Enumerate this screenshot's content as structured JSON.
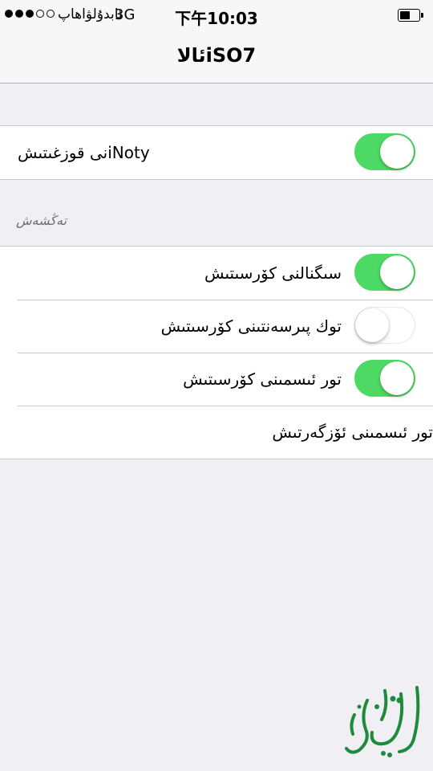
{
  "status_bar": {
    "signal_full": 3,
    "signal_total": 5,
    "carrier": "ئابدۇلۋاھاپ",
    "network": "3G",
    "time": "下午10:03",
    "battery_level": 0.55
  },
  "nav": {
    "title": "ئالاiSO7"
  },
  "group1": {
    "rows": [
      {
        "label": "نى قوزغىتىشiNoty",
        "toggle_on": true
      }
    ]
  },
  "section": {
    "header": "تەڭشەش"
  },
  "group2": {
    "rows": [
      {
        "label": "سىگنالنى كۆرسىتىش",
        "toggle_on": true
      },
      {
        "label": "توك پىرسەنتىنى كۆرسىتىش",
        "toggle_on": false
      },
      {
        "label": "تور ئىسمىنى كۆرسىتىش",
        "toggle_on": true
      },
      {
        "label": "تور ئىسمىنى ئۆزگەرتىش"
      }
    ]
  },
  "watermark": {
    "logo_text": "ئاليۇقرى",
    "color": "#1e8a3c"
  },
  "colors": {
    "toggle_on": "#4cd964",
    "background": "#efeff4",
    "separator": "#c8c7cc"
  }
}
